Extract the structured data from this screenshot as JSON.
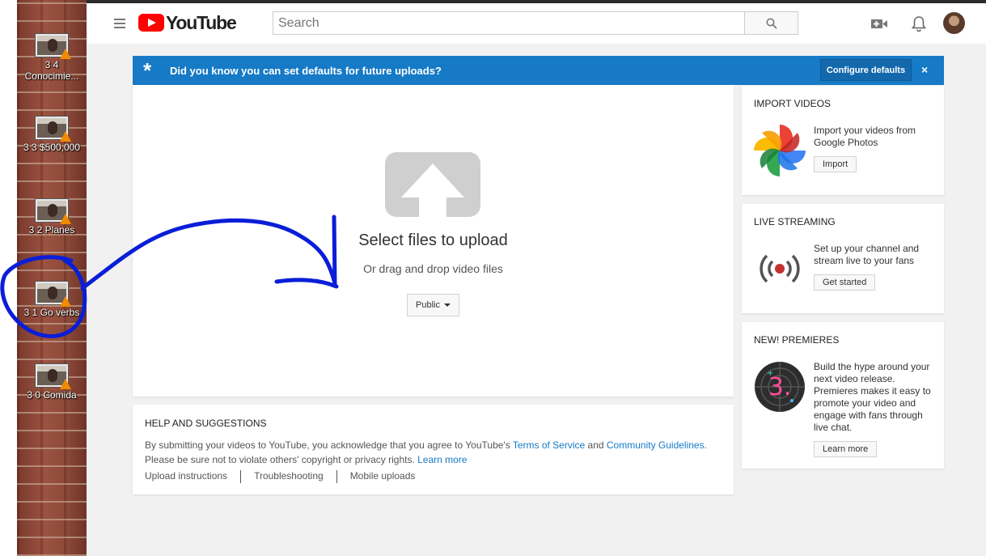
{
  "desktop": {
    "icons": [
      {
        "label": "3 4 Conocimie..."
      },
      {
        "label": "3 3 $500,000"
      },
      {
        "label": "3 2 Planes"
      },
      {
        "label": "3 1 Go verbs"
      },
      {
        "label": "3 0 Comida"
      }
    ]
  },
  "masthead": {
    "logo_text": "YouTube",
    "search_placeholder": "Search",
    "icons": [
      "menu-icon",
      "search-icon",
      "video-camera-add-icon",
      "bell-icon",
      "avatar"
    ]
  },
  "banner": {
    "message": "Did you know you can set defaults for future uploads?",
    "button": "Configure defaults",
    "close": "×",
    "star": "*"
  },
  "upload": {
    "title": "Select files to upload",
    "subtitle": "Or drag and drop video files",
    "privacy": "Public"
  },
  "help": {
    "title": "HELP AND SUGGESTIONS",
    "text_before": "By submitting your videos to YouTube, you acknowledge that you agree to YouTube's ",
    "tos": "Terms of Service",
    "and": " and ",
    "guidelines": "Community Guidelines",
    "text_mid": ". Please be sure not to violate others' copyright or privacy rights. ",
    "learn_more": "Learn more",
    "links": [
      "Upload instructions",
      "Troubleshooting",
      "Mobile uploads"
    ]
  },
  "side": {
    "import": {
      "title": "IMPORT VIDEOS",
      "text": "Import your videos from Google Photos",
      "button": "Import"
    },
    "live": {
      "title": "LIVE STREAMING",
      "text": "Set up your channel and stream live to your fans",
      "button": "Get started"
    },
    "premieres": {
      "title": "NEW! PREMIERES",
      "text": "Build the hype around your next video release. Premieres makes it easy to promote your video and engage with fans through live chat.",
      "button": "Learn more",
      "badge": "3."
    }
  },
  "colors": {
    "brand_red": "#ff0000",
    "banner_blue": "#167ac6",
    "link_blue": "#167ac6",
    "annotation_blue": "#0a1ed8"
  }
}
